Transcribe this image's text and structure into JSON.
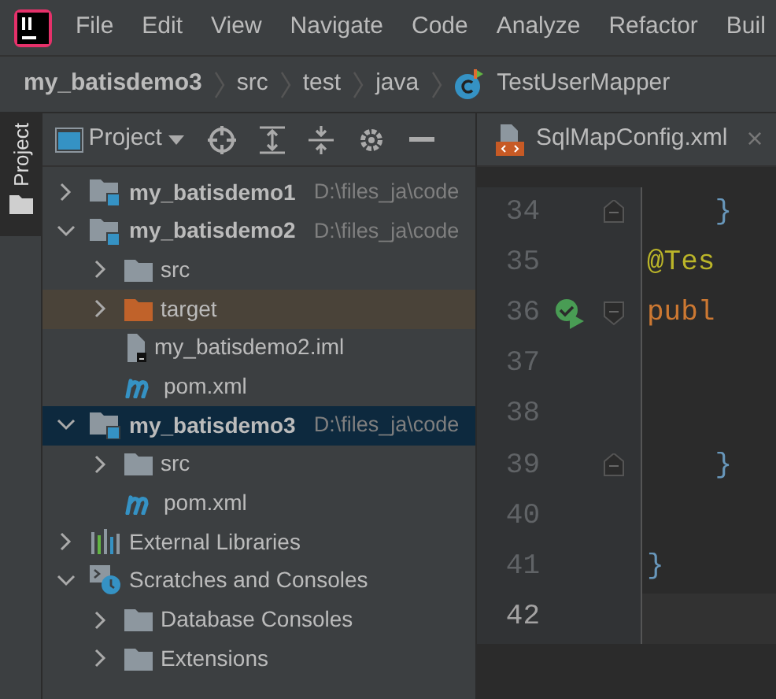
{
  "menu": [
    "File",
    "Edit",
    "View",
    "Navigate",
    "Code",
    "Analyze",
    "Refactor",
    "Buil"
  ],
  "breadcrumb": [
    {
      "text": "my_batisdemo3",
      "kind": "module"
    },
    {
      "text": "src",
      "kind": "folder"
    },
    {
      "text": "test",
      "kind": "folder"
    },
    {
      "text": "java",
      "kind": "folder"
    },
    {
      "text": "TestUserMapper",
      "kind": "class"
    }
  ],
  "side_tab": {
    "label": "Project",
    "selected": true
  },
  "project_panel": {
    "title": "Project",
    "tree": [
      {
        "name": "my_batisdemo1",
        "kind": "module",
        "path": "D:\\files_ja\\code",
        "expanded": false,
        "selected": false,
        "highlighted": false
      },
      {
        "name": "my_batisdemo2",
        "kind": "module",
        "path": "D:\\files_ja\\code",
        "expanded": true,
        "selected": false,
        "highlighted": false,
        "children": [
          {
            "name": "src",
            "kind": "folder",
            "expanded": false,
            "selected": false,
            "highlighted": false
          },
          {
            "name": "target",
            "kind": "excluded-folder",
            "expanded": false,
            "selected": false,
            "highlighted": true
          },
          {
            "name": "my_batisdemo2.iml",
            "kind": "iml",
            "selected": false,
            "highlighted": false
          },
          {
            "name": "pom.xml",
            "kind": "maven",
            "selected": false,
            "highlighted": false
          }
        ]
      },
      {
        "name": "my_batisdemo3",
        "kind": "module",
        "path": "D:\\files_ja\\code",
        "expanded": true,
        "selected": true,
        "highlighted": false,
        "children": [
          {
            "name": "src",
            "kind": "folder",
            "expanded": false,
            "selected": false,
            "highlighted": false
          },
          {
            "name": "pom.xml",
            "kind": "maven",
            "selected": false,
            "highlighted": false
          }
        ]
      },
      {
        "name": "External Libraries",
        "kind": "libraries",
        "expanded": false,
        "selected": false,
        "highlighted": false
      },
      {
        "name": "Scratches and Consoles",
        "kind": "scratches",
        "expanded": true,
        "selected": false,
        "highlighted": false,
        "children": [
          {
            "name": "Database Consoles",
            "kind": "folder",
            "expanded": false,
            "selected": false,
            "highlighted": false
          },
          {
            "name": "Extensions",
            "kind": "folder",
            "expanded": false,
            "selected": false,
            "highlighted": false
          }
        ]
      }
    ]
  },
  "editor": {
    "tab": {
      "label": "SqlMapConfig.xml",
      "close": "×"
    },
    "lines": [
      {
        "number": "34",
        "fold_start": false,
        "fold_end": true,
        "run": false,
        "current": false,
        "tokens": [
          {
            "text": "    }",
            "kind": "brace"
          }
        ]
      },
      {
        "number": "35",
        "fold_start": false,
        "fold_end": false,
        "run": false,
        "current": false,
        "tokens": [
          {
            "text": "@Tes",
            "kind": "annotation"
          }
        ]
      },
      {
        "number": "36",
        "fold_start": true,
        "fold_end": false,
        "run": true,
        "current": false,
        "tokens": [
          {
            "text": "publ",
            "kind": "keyword"
          }
        ]
      },
      {
        "number": "37",
        "fold_start": false,
        "fold_end": false,
        "run": false,
        "current": false
      },
      {
        "number": "38",
        "fold_start": false,
        "fold_end": false,
        "run": false,
        "current": false
      },
      {
        "number": "39",
        "fold_start": false,
        "fold_end": true,
        "run": false,
        "current": false,
        "tokens": [
          {
            "text": "    }",
            "kind": "brace"
          }
        ]
      },
      {
        "number": "40",
        "fold_start": false,
        "fold_end": false,
        "run": false,
        "current": false
      },
      {
        "number": "41",
        "fold_start": false,
        "fold_end": false,
        "run": false,
        "current": false,
        "tokens": [
          {
            "text": "}",
            "kind": "brace"
          }
        ]
      },
      {
        "number": "42",
        "fold_start": false,
        "fold_end": false,
        "run": false,
        "current": true
      }
    ]
  }
}
